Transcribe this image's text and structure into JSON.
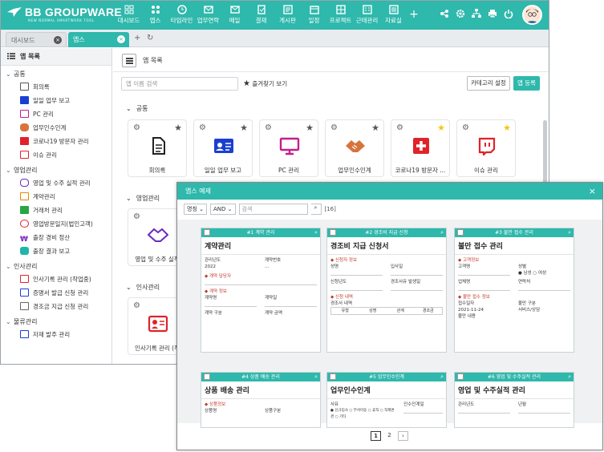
{
  "brand": {
    "name": "BB GROUPWARE",
    "tagline": "NEW NORMAL SMARTWORK TOOL"
  },
  "nav": [
    {
      "label": "대시보드",
      "icon": "dashboard-icon"
    },
    {
      "label": "앱스",
      "icon": "apps-icon"
    },
    {
      "label": "타임라인",
      "icon": "history-icon"
    },
    {
      "label": "업무연락",
      "icon": "mail-icon"
    },
    {
      "label": "메일",
      "icon": "envelope-icon"
    },
    {
      "label": "결재",
      "icon": "approval-icon"
    },
    {
      "label": "게시판",
      "icon": "board-icon"
    },
    {
      "label": "일정",
      "icon": "calendar-icon"
    },
    {
      "label": "프로젝트",
      "icon": "project-icon"
    },
    {
      "label": "근태관리",
      "icon": "attendance-icon"
    },
    {
      "label": "자료실",
      "icon": "archive-icon"
    }
  ],
  "tabs": [
    {
      "label": "대시보드"
    },
    {
      "label": "앱스"
    }
  ],
  "sidebar": {
    "header": "앱 목록",
    "groups": [
      {
        "label": "공통",
        "items": [
          "회의록",
          "일일 업무 보고",
          "PC 관리",
          "업무인수인계",
          "코로나19 방문자 관리",
          "이슈 관리"
        ]
      },
      {
        "label": "영업관리",
        "items": [
          "영업 및 수주 실적 관리",
          "계약관리",
          "거래처 관리",
          "영업방문일지(법인고객)",
          "출장 경비 정산",
          "출장 결과 보고"
        ]
      },
      {
        "label": "인사관리",
        "items": [
          "인사기록 관리 (작업중)",
          "증명서 발급 신청 관리",
          "경조금 지급 신청 관리"
        ]
      },
      {
        "label": "물류관리",
        "items": [
          "자재 발주 관리"
        ]
      }
    ]
  },
  "main": {
    "title": "앱 목록",
    "search_placeholder": "앱 이름 검색",
    "favorites_label": "즐겨찾기 보기",
    "category_btn": "카테고리 설정",
    "register_btn": "앱 등록",
    "sections": [
      {
        "label": "공통",
        "cards": [
          {
            "label": "회의록",
            "fav": false
          },
          {
            "label": "일일 업무 보고",
            "fav": false
          },
          {
            "label": "PC 관리",
            "fav": false
          },
          {
            "label": "업무인수인계",
            "fav": false
          },
          {
            "label": "코로나19 방문자 ...",
            "fav": true
          },
          {
            "label": "이슈 관리",
            "fav": true
          }
        ]
      },
      {
        "label": "영업관리",
        "cards": [
          {
            "label": "영업 및 수주 실적"
          }
        ]
      },
      {
        "label": "인사관리",
        "cards": [
          {
            "label": "인사기록 관리 (작"
          }
        ]
      }
    ]
  },
  "popup": {
    "title": "앱스 예제",
    "filter_field": "명칭",
    "filter_op": "AND",
    "search_placeholder": "검색",
    "count": "[16]",
    "cards": [
      {
        "header": "#1 계약 관리",
        "title": "계약관리",
        "lines": [
          "관리년도",
          "계약번호",
          "2022",
          "계약 담당자",
          "계약 정보",
          "계약명",
          "계약일",
          "계약 구분",
          "계약 금액"
        ]
      },
      {
        "header": "#2 경조비 지급 신청",
        "title": "경조비 지급 신청서",
        "lines": [
          "신청자 정보",
          "성명",
          "입사일",
          "신청년도",
          "경조사유 발생일",
          "신청 내역",
          "경조사 내역",
          "유형",
          "성명",
          "관계",
          "경조금"
        ]
      },
      {
        "header": "#3 불만 접수 관리",
        "title": "불만 접수 관리",
        "lines": [
          "고객정보",
          "고객명",
          "성별",
          "남성",
          "여성",
          "업체명",
          "연락처",
          "불만 접수 정보",
          "접수일자",
          "불만 구분",
          "2021-11-24",
          "서비스/상담",
          "불만 내용"
        ]
      },
      {
        "header": "#4 상품 배송 관리",
        "title": "상품 배송 관리",
        "lines": [
          "상품정보",
          "상품명",
          "상품구분"
        ]
      },
      {
        "header": "#5 업무인수인계",
        "title": "업무인수인계",
        "lines": [
          "사유",
          "인수인계일",
          "신규입사",
          "부서이동",
          "휴직",
          "직제변경",
          "기타"
        ]
      },
      {
        "header": "#6 영업 및 수주실적 관리",
        "title": "영업 및 수주실적 관리",
        "lines": [
          "관리년도",
          "년월"
        ]
      }
    ],
    "pages": [
      "1",
      "2"
    ]
  },
  "colors": {
    "accent": "#2fb8ac",
    "red": "#c0392b",
    "star": "#f5c518"
  }
}
